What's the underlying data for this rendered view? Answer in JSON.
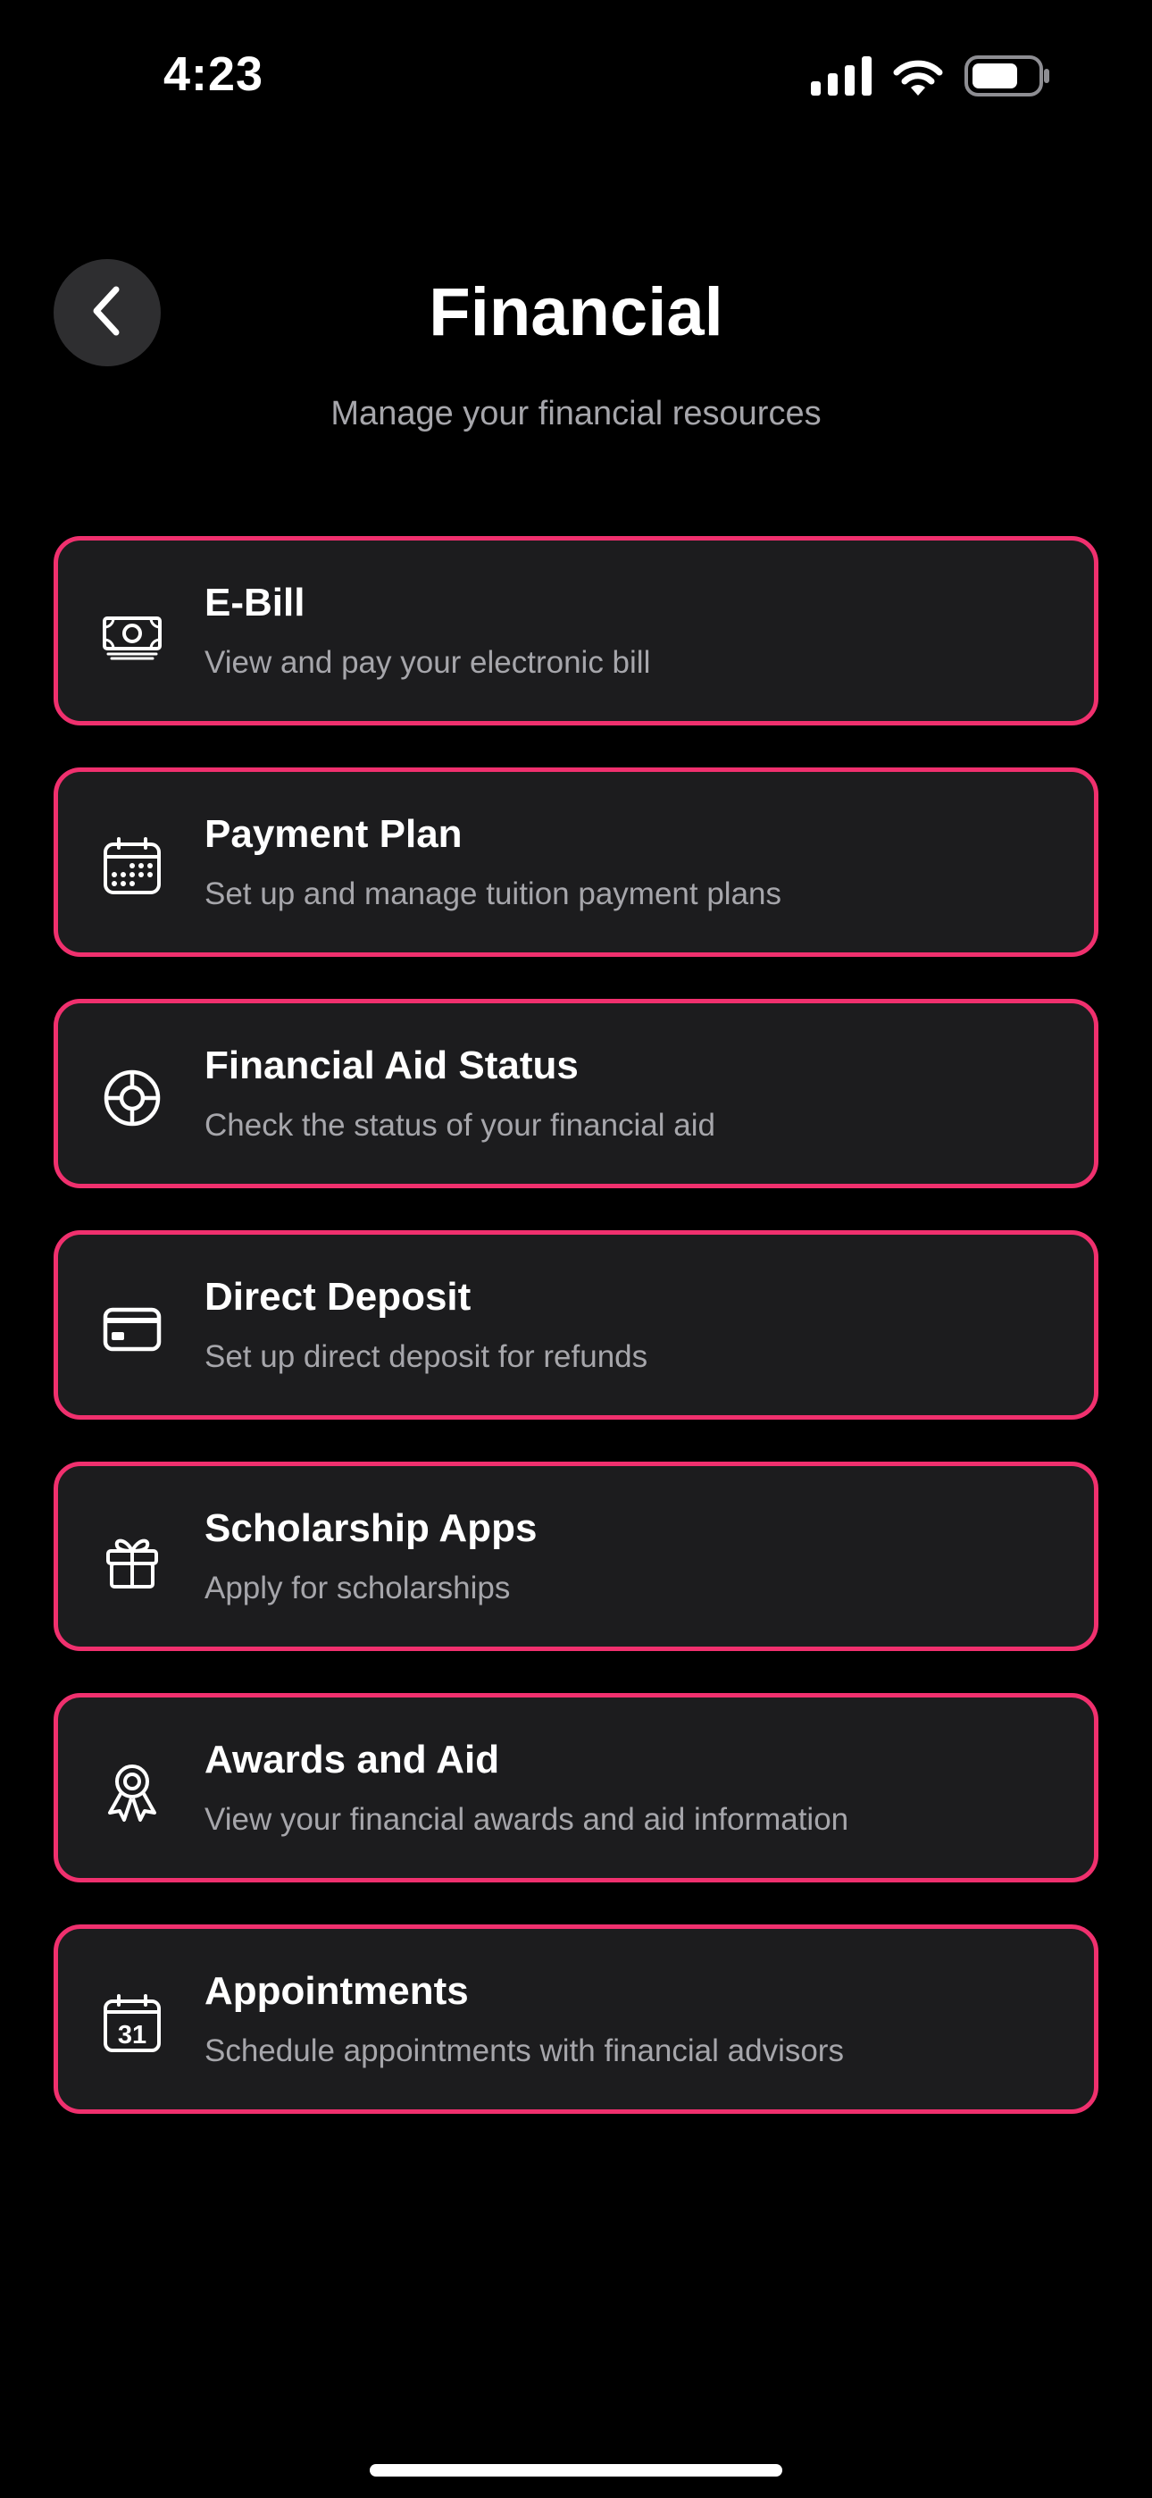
{
  "status_bar": {
    "time": "4:23",
    "icons": [
      "cellular-signal-icon",
      "wifi-icon",
      "battery-icon"
    ]
  },
  "header": {
    "back_icon": "chevron-left-icon",
    "title": "Financial",
    "subtitle": "Manage your financial resources"
  },
  "theme": {
    "accent": "#f0306e",
    "card_background": "#1c1c1e",
    "page_background": "#000000",
    "secondary_text": "#a6a6ab"
  },
  "menu": {
    "items": [
      {
        "icon": "banknote-icon",
        "title": "E-Bill",
        "description": "View and pay your electronic bill"
      },
      {
        "icon": "calendar-icon",
        "title": "Payment Plan",
        "description": "Set up and manage tuition payment plans"
      },
      {
        "icon": "lifebuoy-icon",
        "title": "Financial Aid Status",
        "description": "Check the status of your financial aid"
      },
      {
        "icon": "credit-card-icon",
        "title": "Direct Deposit",
        "description": "Set up direct deposit for refunds"
      },
      {
        "icon": "gift-icon",
        "title": "Scholarship Apps",
        "description": "Apply for scholarships"
      },
      {
        "icon": "award-ribbon-icon",
        "title": "Awards and Aid",
        "description": "View your financial awards and aid information"
      },
      {
        "icon": "calendar-31-icon",
        "title": "Appointments",
        "description": "Schedule appointments with financial advisors",
        "icon_text": "31"
      }
    ]
  }
}
